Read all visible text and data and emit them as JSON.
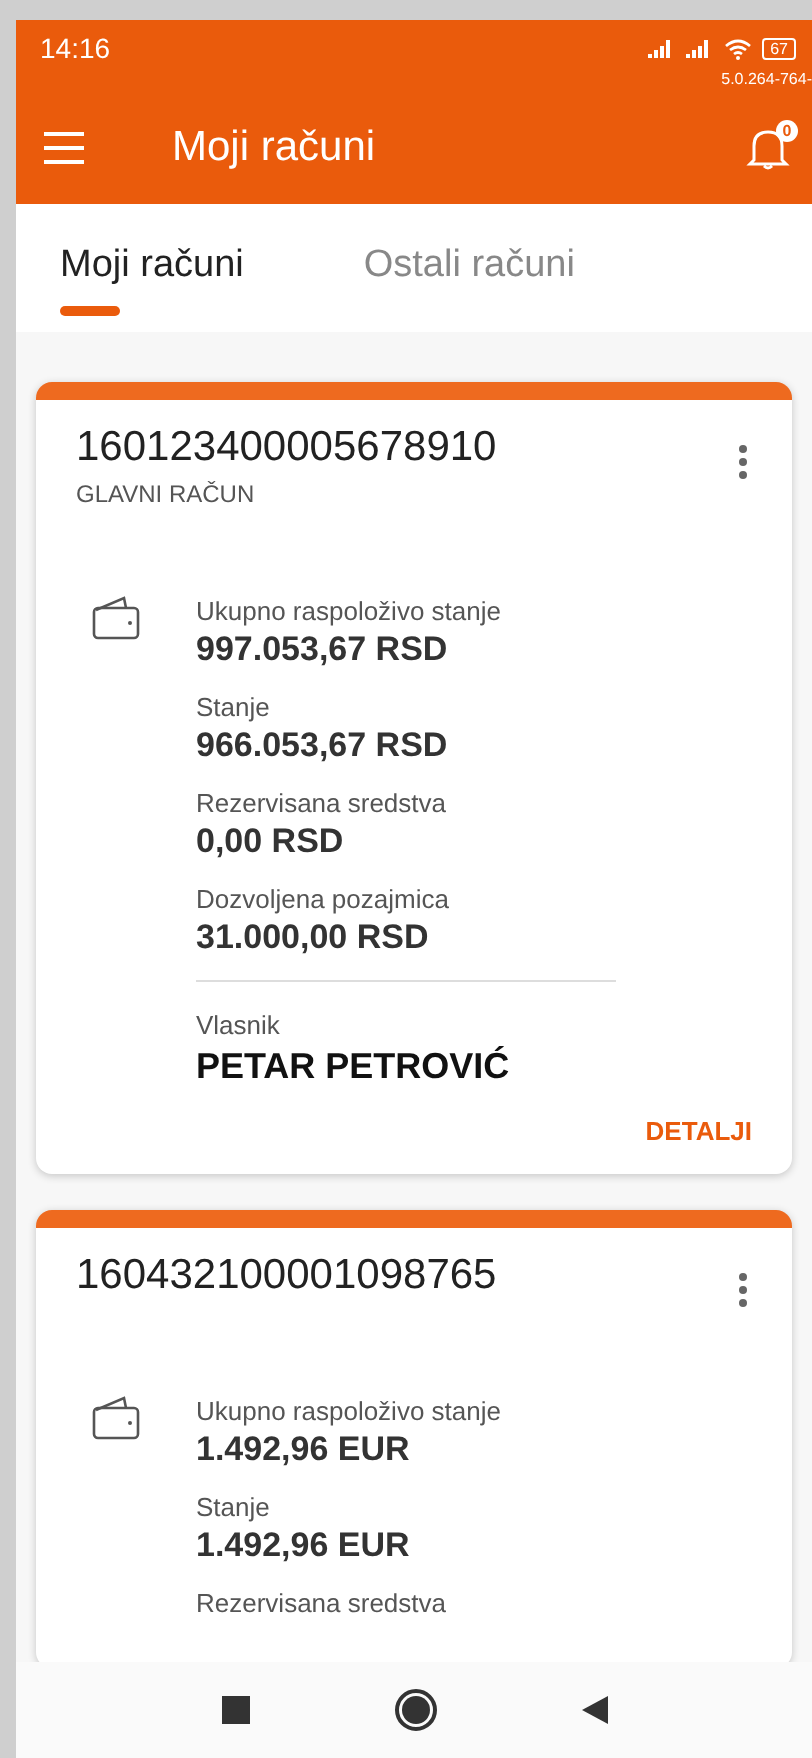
{
  "status_bar": {
    "time": "14:16",
    "battery": "67",
    "version": "5.0.264-764-"
  },
  "header": {
    "title": "Moji računi",
    "notifications": "0"
  },
  "tabs": [
    {
      "label": "Moji računi",
      "selected": true
    },
    {
      "label": "Ostali računi",
      "selected": false
    }
  ],
  "accounts": [
    {
      "number": "160123400005678910",
      "subtitle": "GLAVNI RAČUN",
      "fields": [
        {
          "label": "Ukupno raspoloživo stanje",
          "value": "997.053,67 RSD"
        },
        {
          "label": "Stanje",
          "value": "966.053,67 RSD"
        },
        {
          "label": "Rezervisana sredstva",
          "value": "0,00 RSD"
        },
        {
          "label": "Dozvoljena pozajmica",
          "value": "31.000,00 RSD"
        }
      ],
      "owner_label": "Vlasnik",
      "owner": "PETAR PETROVIĆ",
      "action": "DETALJI"
    },
    {
      "number": "160432100001098765",
      "fields": [
        {
          "label": "Ukupno raspoloživo stanje",
          "value": "1.492,96 EUR"
        },
        {
          "label": "Stanje",
          "value": "1.492,96 EUR"
        },
        {
          "label": "Rezervisana sredstva"
        }
      ]
    }
  ]
}
